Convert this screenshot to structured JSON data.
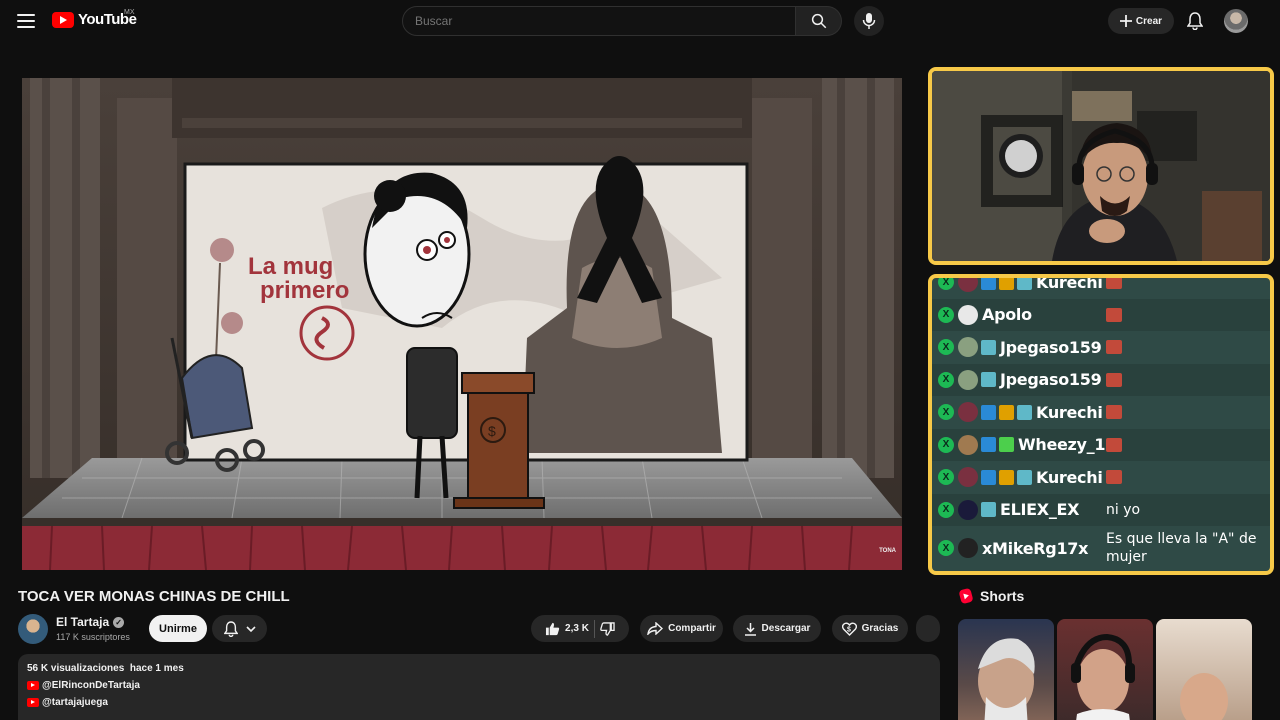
{
  "header": {
    "logo_text": "YouTube",
    "country_code": "MX",
    "search_placeholder": "Buscar",
    "create_label": "Crear"
  },
  "video": {
    "title": "TOCA VER MONAS CHINAS DE CHILL",
    "scene_text_line1": "La mug",
    "scene_text_line2": "primero",
    "watermark": "TONA"
  },
  "channel": {
    "name": "El Tartaja",
    "subscribers": "117 K suscriptores",
    "join_label": "Unirme"
  },
  "actions": {
    "likes": "2,3 K",
    "share_label": "Compartir",
    "download_label": "Descargar",
    "thanks_label": "Gracias"
  },
  "description": {
    "views": "56 K visualizaciones",
    "age": "hace 1 mes",
    "links": [
      "@ElRinconDeTartaja",
      "@tartajajuega"
    ]
  },
  "chat": {
    "messages": [
      {
        "user": "Kurechi",
        "text": ""
      },
      {
        "user": "Apolo",
        "text": ""
      },
      {
        "user": "Jpegaso159",
        "text": ""
      },
      {
        "user": "Jpegaso159",
        "text": ""
      },
      {
        "user": "Kurechi",
        "text": ""
      },
      {
        "user": "Wheezy_1",
        "text": ""
      },
      {
        "user": "Kurechi",
        "text": ""
      },
      {
        "user": "ELIEX_EX",
        "text": "ni yo"
      },
      {
        "user": "xMikeRg17x",
        "text": "Es que lleva la \"A\" de mujer"
      }
    ]
  },
  "shorts": {
    "title": "Shorts"
  },
  "colors": {
    "accent_border": "#f7c948",
    "chat_bg": "#2f4a46",
    "brand_red": "#ff0000"
  }
}
